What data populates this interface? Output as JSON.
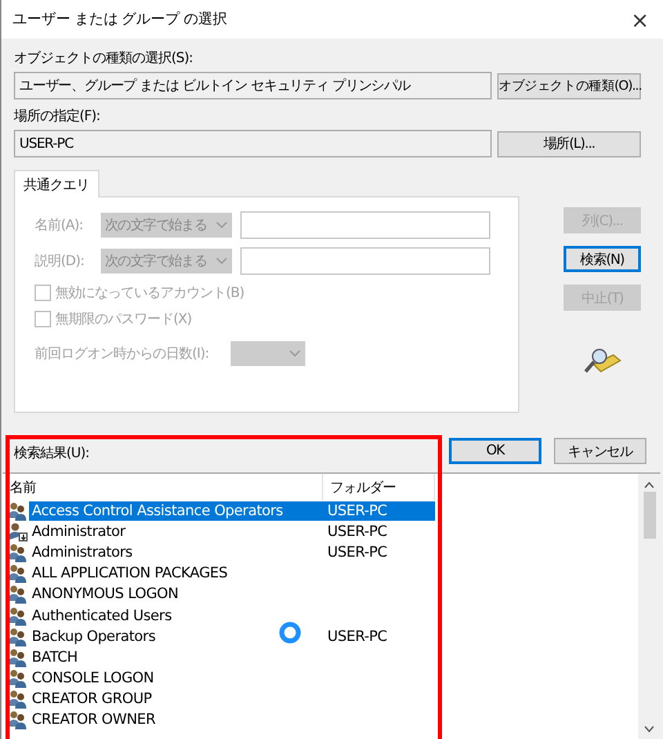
{
  "window": {
    "title": "ユーザー または グループ の選択",
    "close": "×"
  },
  "object_type": {
    "label": "オブジェクトの種類の選択(S):",
    "value": "ユーザー、グループ または ビルトイン セキュリティ プリンシパル",
    "button": "オブジェクトの種類(O)..."
  },
  "location": {
    "label": "場所の指定(F):",
    "value": "USER-PC",
    "button": "場所(L)..."
  },
  "tabs": [
    {
      "label": "共通クエリ",
      "selected": true
    }
  ],
  "query": {
    "rows": [
      {
        "label": "名前(A):",
        "option": "次の文字で始まる"
      },
      {
        "label": "説明(D):",
        "option": "次の文字で始まる"
      }
    ],
    "checkboxes": [
      {
        "label": "無効になっているアカウント(B)",
        "checked": false,
        "disabled": true
      },
      {
        "label": "無期限のパスワード(X)",
        "checked": false,
        "disabled": true
      }
    ],
    "days_label": "前回ログオン時からの日数(I):"
  },
  "side_buttons": [
    {
      "label": "列(C)...",
      "disabled": true
    },
    {
      "label": "検索(N)",
      "disabled": false
    },
    {
      "label": "中止(T)",
      "disabled": true
    }
  ],
  "dialog_buttons": [
    {
      "label": "OK",
      "default": true
    },
    {
      "label": "キャンセル",
      "default": false
    }
  ],
  "results": {
    "label": "検索結果(U):",
    "columns": [
      "名前",
      "フォルダー"
    ],
    "rows": [
      {
        "name": "Access Control Assistance Operators",
        "folder": "USER-PC",
        "kind": "group",
        "selected": true
      },
      {
        "name": "Administrator",
        "folder": "USER-PC",
        "kind": "user",
        "selected": false
      },
      {
        "name": "Administrators",
        "folder": "USER-PC",
        "kind": "group",
        "selected": false
      },
      {
        "name": "ALL APPLICATION PACKAGES",
        "kind": "group",
        "selected": false
      },
      {
        "name": "ANONYMOUS LOGON",
        "kind": "group",
        "selected": false
      },
      {
        "name": "Authenticated Users",
        "kind": "group",
        "selected": false
      },
      {
        "name": "Backup Operators",
        "folder": "USER-PC",
        "kind": "group",
        "selected": false
      },
      {
        "name": "BATCH",
        "kind": "group",
        "selected": false
      },
      {
        "name": "CONSOLE LOGON",
        "kind": "group",
        "selected": false
      },
      {
        "name": "CREATOR GROUP",
        "kind": "group",
        "selected": false
      },
      {
        "name": "CREATOR OWNER",
        "kind": "group",
        "selected": false
      }
    ]
  }
}
